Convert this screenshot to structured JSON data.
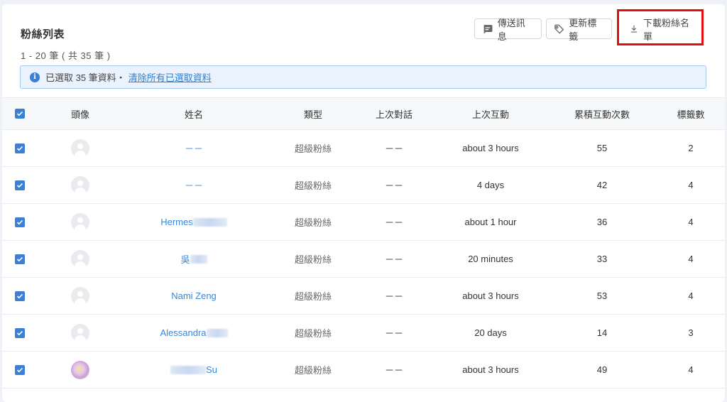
{
  "header": {
    "title": "粉絲列表",
    "subtitle": "1 - 20 筆 ( 共 35 筆 )"
  },
  "actions": {
    "send_message": "傳送訊息",
    "update_tags": "更新標籤",
    "download_list": "下載粉絲名單"
  },
  "banner": {
    "text": "已選取 35 筆資料・",
    "clear_link": "清除所有已選取資料"
  },
  "table": {
    "columns": [
      "頭像",
      "姓名",
      "類型",
      "上次對話",
      "上次互動",
      "累積互動次數",
      "標籤數"
    ],
    "rows": [
      {
        "name": "－－",
        "type": "超級粉絲",
        "last_chat": "－－",
        "last_interaction": "about 3 hours",
        "count": "55",
        "tags": "2"
      },
      {
        "name": "－－",
        "type": "超級粉絲",
        "last_chat": "－－",
        "last_interaction": "4 days",
        "count": "42",
        "tags": "4"
      },
      {
        "name": "Hermes",
        "type": "超級粉絲",
        "last_chat": "－－",
        "last_interaction": "about 1 hour",
        "count": "36",
        "tags": "4"
      },
      {
        "name": "吳",
        "type": "超級粉絲",
        "last_chat": "－－",
        "last_interaction": "20 minutes",
        "count": "33",
        "tags": "4"
      },
      {
        "name": "Nami Zeng",
        "type": "超級粉絲",
        "last_chat": "－－",
        "last_interaction": "about 3 hours",
        "count": "53",
        "tags": "4"
      },
      {
        "name": "Alessandra",
        "type": "超級粉絲",
        "last_chat": "－－",
        "last_interaction": "20 days",
        "count": "14",
        "tags": "3"
      },
      {
        "name": "Su",
        "type": "超級粉絲",
        "last_chat": "－－",
        "last_interaction": "about 3 hours",
        "count": "49",
        "tags": "4"
      }
    ]
  },
  "colors": {
    "accent": "#3b7fd6",
    "highlight": "#e01010",
    "link": "#3b86d4"
  }
}
